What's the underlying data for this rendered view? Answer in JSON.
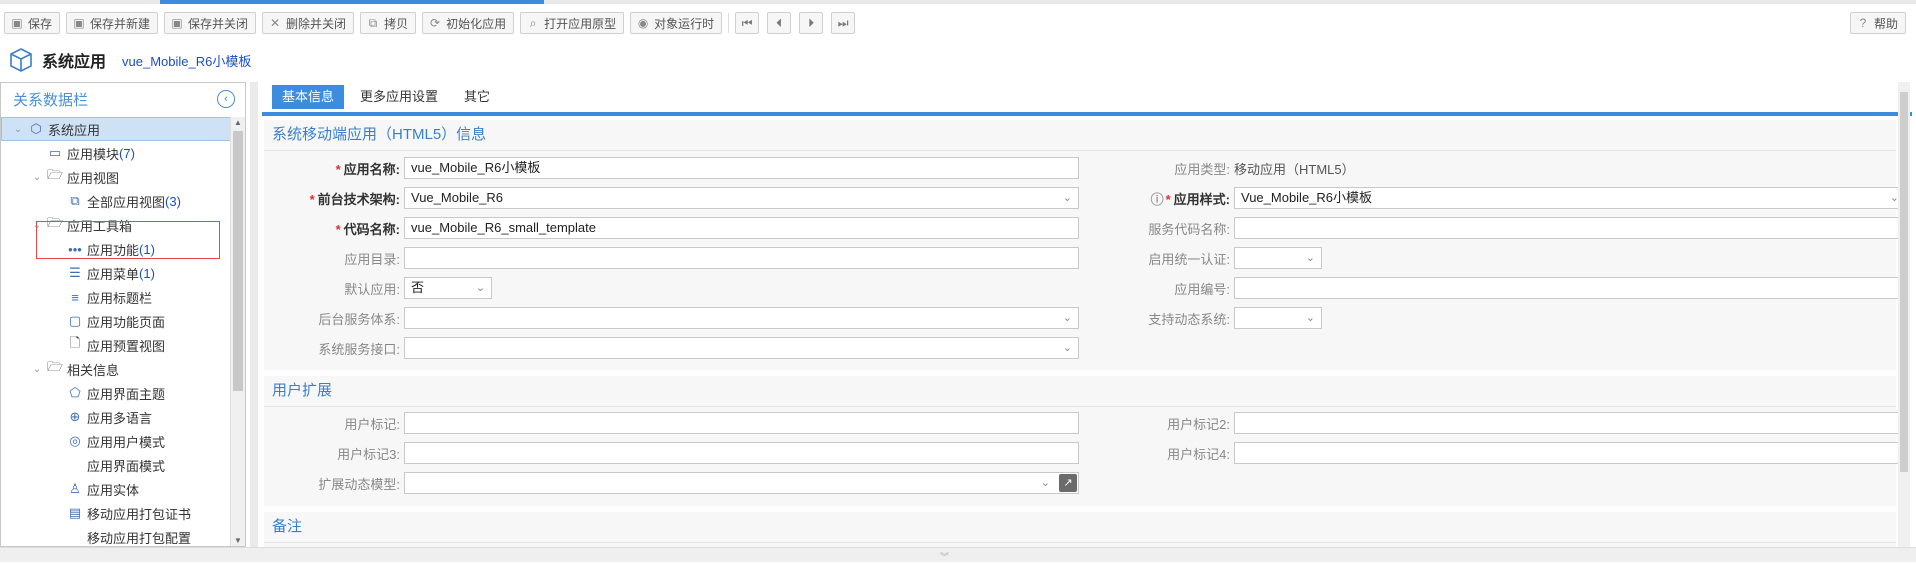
{
  "toolbar": {
    "buttons": [
      {
        "label": "保存",
        "icon": "save-icon"
      },
      {
        "label": "保存并新建",
        "icon": "save-new-icon"
      },
      {
        "label": "保存并关闭",
        "icon": "save-close-icon"
      },
      {
        "label": "删除并关闭",
        "icon": "delete-icon"
      },
      {
        "label": "拷贝",
        "icon": "copy-icon"
      },
      {
        "label": "初始化应用",
        "icon": "refresh-icon"
      },
      {
        "label": "打开应用原型",
        "icon": "search-icon"
      },
      {
        "label": "对象运行时",
        "icon": "eye-icon"
      }
    ],
    "help_label": "帮助"
  },
  "header": {
    "title": "系统应用",
    "subtitle": "vue_Mobile_R6小模板"
  },
  "sidebar": {
    "title": "关系数据栏",
    "items": [
      {
        "label": "系统应用",
        "count": "",
        "level": 0,
        "icon": "cube-icon",
        "selected": true
      },
      {
        "label": "应用模块",
        "count": "(7)",
        "level": 1,
        "icon": "module-icon"
      },
      {
        "label": "应用视图",
        "count": "",
        "level": 1,
        "icon": "folder-icon",
        "expandable": true
      },
      {
        "label": "全部应用视图",
        "count": "(3)",
        "level": 2,
        "icon": "views-icon"
      },
      {
        "label": "应用工具箱",
        "count": "",
        "level": 1,
        "icon": "folder-icon",
        "expandable": true
      },
      {
        "label": "应用功能",
        "count": "(1)",
        "level": 2,
        "icon": "dots-icon"
      },
      {
        "label": "应用菜单",
        "count": "(1)",
        "level": 2,
        "icon": "menu-tree-icon"
      },
      {
        "label": "应用标题栏",
        "count": "",
        "level": 2,
        "icon": "list-icon"
      },
      {
        "label": "应用功能页面",
        "count": "",
        "level": 2,
        "icon": "page-icon"
      },
      {
        "label": "应用预置视图",
        "count": "",
        "level": 2,
        "icon": "document-icon"
      },
      {
        "label": "相关信息",
        "count": "",
        "level": 1,
        "icon": "folder-icon",
        "expandable": true
      },
      {
        "label": "应用界面主题",
        "count": "",
        "level": 2,
        "icon": "theme-icon"
      },
      {
        "label": "应用多语言",
        "count": "",
        "level": 2,
        "icon": "globe-icon"
      },
      {
        "label": "应用用户模式",
        "count": "",
        "level": 2,
        "icon": "user-mode-icon"
      },
      {
        "label": "应用界面模式",
        "count": "",
        "level": 2,
        "icon": ""
      },
      {
        "label": "应用实体",
        "count": "",
        "level": 2,
        "icon": "entity-icon"
      },
      {
        "label": "移动应用打包证书",
        "count": "",
        "level": 2,
        "icon": "certificate-icon"
      },
      {
        "label": "移动应用打包配置",
        "count": "",
        "level": 2,
        "icon": ""
      }
    ]
  },
  "tabs": [
    {
      "label": "基本信息",
      "active": true
    },
    {
      "label": "更多应用设置",
      "active": false
    },
    {
      "label": "其它",
      "active": false
    }
  ],
  "sections": {
    "basic": {
      "title": "系统移动端应用（HTML5）信息",
      "app_name_label": "应用名称:",
      "app_name_value": "vue_Mobile_R6小模板",
      "app_type_label": "应用类型:",
      "app_type_value": "移动应用（HTML5）",
      "frontend_label": "前台技术架构:",
      "frontend_value": "Vue_Mobile_R6",
      "app_style_label": "应用样式:",
      "app_style_value": "Vue_Mobile_R6小模板",
      "code_name_label": "代码名称:",
      "code_name_value": "vue_Mobile_R6_small_template",
      "service_code_label": "服务代码名称:",
      "service_code_value": "",
      "app_dir_label": "应用目录:",
      "app_dir_value": "",
      "unified_auth_label": "启用统一认证:",
      "unified_auth_value": "",
      "default_app_label": "默认应用:",
      "default_app_value": "否",
      "app_number_label": "应用编号:",
      "app_number_value": "",
      "backend_system_label": "后台服务体系:",
      "backend_system_value": "",
      "dynamic_system_label": "支持动态系统:",
      "dynamic_system_value": "",
      "service_api_label": "系统服务接口:",
      "service_api_value": ""
    },
    "user_ext": {
      "title": "用户扩展",
      "tag1_label": "用户标记:",
      "tag1_value": "",
      "tag2_label": "用户标记2:",
      "tag2_value": "",
      "tag3_label": "用户标记3:",
      "tag3_value": "",
      "tag4_label": "用户标记4:",
      "tag4_value": "",
      "dyn_model_label": "扩展动态模型:",
      "dyn_model_value": ""
    },
    "remark": {
      "title": "备注"
    }
  }
}
